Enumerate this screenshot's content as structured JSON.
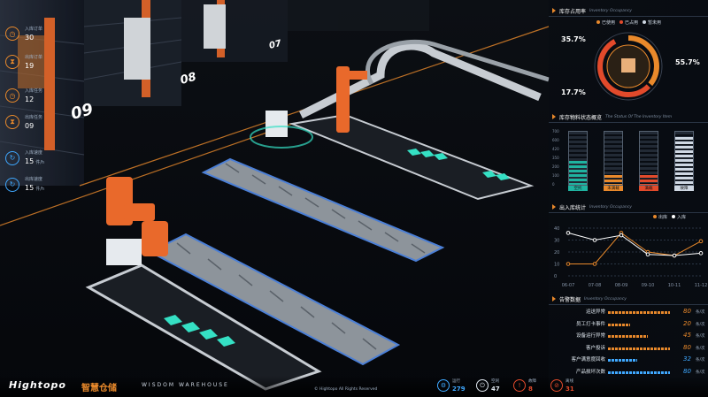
{
  "left_panel": [
    {
      "icon": "clock-icon",
      "label": "入库订单",
      "value": "30",
      "color": "#e9892b"
    },
    {
      "icon": "hourglass-icon",
      "label": "出库订单",
      "value": "19",
      "color": "#e9892b"
    },
    {
      "icon": "clock-icon",
      "label": "入库任务",
      "value": "12",
      "color": "#e9892b"
    },
    {
      "icon": "hourglass-icon",
      "label": "出库任务",
      "value": "09",
      "color": "#e9892b"
    },
    {
      "icon": "refresh-icon",
      "label": "入库速度",
      "value": "15",
      "unit": "件/h",
      "color": "#3fa8ff"
    },
    {
      "icon": "refresh-icon",
      "label": "出库速度",
      "value": "15",
      "unit": "件/h",
      "color": "#3fa8ff"
    }
  ],
  "scene_labels": [
    "09",
    "08",
    "07"
  ],
  "occupancy": {
    "title": "库存占用率",
    "title_en": "Inventory Occupancy",
    "legend": [
      {
        "label": "已使用",
        "color": "#e9892b"
      },
      {
        "label": "已占用",
        "color": "#e24a2b"
      },
      {
        "label": "暂未用",
        "color": "#cfd8e3"
      }
    ],
    "values": {
      "a": "35.7%",
      "b": "55.7%",
      "c": "17.7%"
    }
  },
  "inventory": {
    "title": "库存物料状态概览",
    "title_en": "The Status Of The Inventory Item",
    "y_ticks": [
      "700",
      "600",
      "420",
      "350",
      "200",
      "100",
      "0"
    ],
    "bars": [
      {
        "label": "空托",
        "fill": 0.45,
        "color": "#1fb3a0"
      },
      {
        "label": "未满载",
        "fill": 0.18,
        "color": "#e9892b"
      },
      {
        "label": "满载",
        "fill": 0.18,
        "color": "#e24a2b"
      },
      {
        "label": "故障",
        "fill": 0.9,
        "color": "#cfd8e3"
      }
    ]
  },
  "io_stats": {
    "title": "出入库统计",
    "title_en": "Inventory Occupancy",
    "legend": [
      {
        "label": "出库",
        "color": "#e9892b"
      },
      {
        "label": "入库",
        "color": "#ffffff"
      }
    ],
    "y_ticks": [
      "40",
      "30",
      "20",
      "10",
      "0"
    ],
    "chart_data": {
      "type": "line",
      "categories": [
        "06-07",
        "07-08",
        "08-09",
        "09-10",
        "10-11",
        "11-12"
      ],
      "series": [
        {
          "name": "出库",
          "values": [
            10,
            10,
            36,
            20,
            17,
            29
          ],
          "color": "#e9892b"
        },
        {
          "name": "入库",
          "values": [
            36,
            30,
            34,
            18,
            17,
            19
          ],
          "color": "#ffffff"
        }
      ],
      "ylim": [
        0,
        40
      ]
    }
  },
  "alarms": {
    "title": "告警数据",
    "title_en": "Inventory Occupancy",
    "rows": [
      {
        "name": "运送异常",
        "value": "80",
        "unit": "条/次",
        "color": "#e9892b",
        "fill": 0.85
      },
      {
        "name": "员工打卡事件",
        "value": "20",
        "unit": "条/次",
        "color": "#e9892b",
        "fill": 0.3
      },
      {
        "name": "设备运行异常",
        "value": "45",
        "unit": "条/次",
        "color": "#e9892b",
        "fill": 0.55
      },
      {
        "name": "客户投诉",
        "value": "80",
        "unit": "条/次",
        "color": "#e9892b",
        "fill": 0.85
      },
      {
        "name": "客户满意度回收",
        "value": "32",
        "unit": "条/次",
        "color": "#3fa8ff",
        "fill": 0.4
      },
      {
        "name": "产品损坏次数",
        "value": "80",
        "unit": "条/次",
        "color": "#3fa8ff",
        "fill": 0.85
      }
    ]
  },
  "bottom": {
    "brand": "Hightopo",
    "brand_cn": "智慧仓储",
    "brand_en": "WISDOM WAREHOUSE",
    "copyright": "© Hightopo All Rights Reserved",
    "stats": [
      {
        "icon": "gear-icon",
        "label": "运行",
        "value": "279",
        "color": "#3fa8ff"
      },
      {
        "icon": "power-icon",
        "label": "空闲",
        "value": "47",
        "color": "#dfe7ef"
      },
      {
        "icon": "warning-icon",
        "label": "故障",
        "value": "8",
        "color": "#e24a2b"
      },
      {
        "icon": "block-icon",
        "label": "离线",
        "value": "31",
        "color": "#e24a2b"
      }
    ]
  }
}
